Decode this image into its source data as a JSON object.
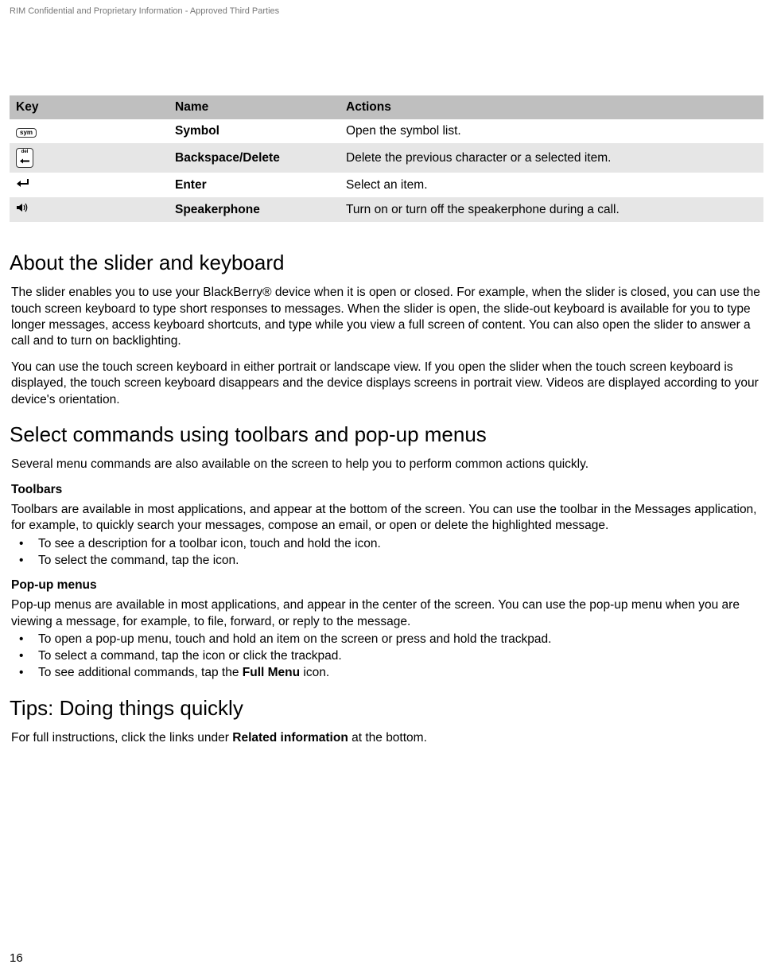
{
  "header": "RIM Confidential and Proprietary Information - Approved Third Parties",
  "table": {
    "headers": {
      "key": "Key",
      "name": "Name",
      "actions": "Actions"
    },
    "rows": [
      {
        "icon": "sym",
        "name": "Symbol",
        "actions": "Open the symbol list."
      },
      {
        "icon": "del",
        "name": "Backspace/Delete",
        "actions": "Delete the previous character or a selected item."
      },
      {
        "icon": "enter",
        "name": "Enter",
        "actions": "Select an item."
      },
      {
        "icon": "speaker",
        "name": "Speakerphone",
        "actions": "Turn on or turn off the speakerphone during a call."
      }
    ]
  },
  "section1": {
    "title": "About the slider and keyboard",
    "p1": "The slider enables you to use your BlackBerry® device when it is open or closed. For example, when the slider is closed, you can use the touch screen keyboard to type short responses to messages. When the slider is open, the slide-out keyboard is available for you to type longer messages, access keyboard shortcuts, and type while you view a full screen of content. You can also open the slider to answer a call and to turn on backlighting.",
    "p2": "You can use the touch screen keyboard in either portrait or landscape view. If you open the slider when the touch screen keyboard is displayed, the touch screen keyboard disappears and the device displays screens in portrait view. Videos are displayed according to your device's orientation."
  },
  "section2": {
    "title": "Select commands using toolbars and pop-up menus",
    "intro": "Several menu commands are also available on the screen to help you to perform common actions quickly.",
    "toolbars_label": "Toolbars",
    "toolbars_p": "Toolbars are available in most applications, and appear at the bottom of the screen. You can use the toolbar in the Messages application, for example, to quickly search your messages, compose an email, or open or delete the highlighted message.",
    "toolbars_items": [
      "To see a description for a toolbar icon, touch and hold the icon.",
      "To select the command, tap the icon."
    ],
    "popup_label": "Pop-up menus",
    "popup_p": "Pop-up menus are available in most applications, and appear in the center of the screen. You can use the pop-up menu when you are viewing a message, for example, to file, forward, or reply to the message.",
    "popup_items": [
      "To open a pop-up menu, touch and hold an item on the screen or press and hold the trackpad.",
      "To select a command, tap the icon or click the trackpad."
    ],
    "popup_item3_pre": "To see additional commands, tap the ",
    "popup_item3_bold": "Full Menu",
    "popup_item3_post": " icon."
  },
  "section3": {
    "title": "Tips: Doing things quickly",
    "p_pre": "For full instructions, click the links under ",
    "p_bold": "Related information",
    "p_post": " at the bottom."
  },
  "page_number": "16",
  "icon_labels": {
    "sym_text": "sym",
    "del_text": "del"
  }
}
